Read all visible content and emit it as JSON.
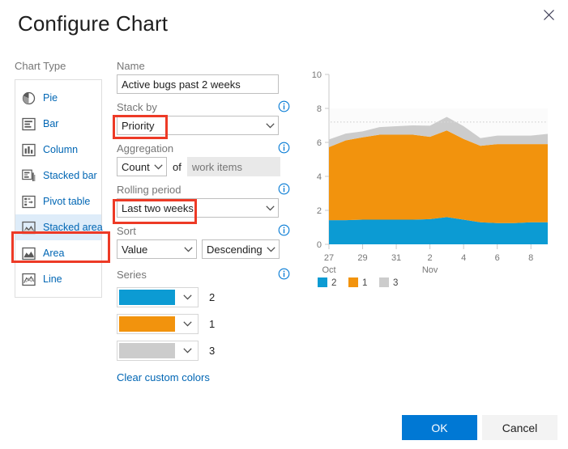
{
  "dialog": {
    "title": "Configure Chart",
    "close_icon": "close-icon"
  },
  "chart_type": {
    "label": "Chart Type",
    "selected": "Stacked area",
    "items": [
      {
        "label": "Pie",
        "icon": "pie-chart-icon"
      },
      {
        "label": "Bar",
        "icon": "bar-chart-icon"
      },
      {
        "label": "Column",
        "icon": "column-chart-icon"
      },
      {
        "label": "Stacked bar",
        "icon": "stacked-bar-chart-icon"
      },
      {
        "label": "Pivot table",
        "icon": "pivot-table-icon"
      },
      {
        "label": "Stacked area",
        "icon": "stacked-area-chart-icon"
      },
      {
        "label": "Area",
        "icon": "area-chart-icon"
      },
      {
        "label": "Line",
        "icon": "line-chart-icon"
      }
    ]
  },
  "form": {
    "name": {
      "label": "Name",
      "value": "Active bugs past 2 weeks",
      "placeholder": ""
    },
    "stack_by": {
      "label": "Stack by",
      "value": "Priority",
      "info_icon": "info-icon"
    },
    "aggregation": {
      "label": "Aggregation",
      "function": "Count",
      "of_label": "of",
      "field_placeholder": "work items",
      "field_value": "",
      "info_icon": "info-icon"
    },
    "rolling_period": {
      "label": "Rolling period",
      "value": "Last two weeks",
      "info_icon": "info-icon"
    },
    "sort": {
      "label": "Sort",
      "by_value": "Value",
      "direction_value": "Descending",
      "info_icon": "info-icon"
    },
    "series": {
      "label": "Series",
      "info_icon": "info-icon",
      "items": [
        {
          "name": "2",
          "color": "#0c9bd3"
        },
        {
          "name": "1",
          "color": "#f2930d"
        },
        {
          "name": "3",
          "color": "#cccccc"
        }
      ],
      "clear_colors_label": "Clear custom colors"
    }
  },
  "footer": {
    "ok_label": "OK",
    "cancel_label": "Cancel"
  },
  "annotations": {
    "accent_color": "#ed3a26",
    "highlighted": [
      "Stacked area",
      "Priority",
      "Last two weeks"
    ]
  },
  "chart_data": {
    "type": "area",
    "stacked": true,
    "title": "",
    "xlabel": "",
    "ylabel": "",
    "ylim": [
      0,
      10
    ],
    "yticks": [
      0,
      2,
      4,
      6,
      8,
      10
    ],
    "grid": false,
    "legend_position": "bottom-left",
    "reference_line": 7.2,
    "x": [
      "27",
      "28",
      "29",
      "30",
      "31",
      "1",
      "2",
      "3",
      "4",
      "5",
      "6",
      "7",
      "8",
      "9"
    ],
    "xticks": [
      "27",
      "29",
      "31",
      "2",
      "4",
      "6",
      "8"
    ],
    "month_labels": [
      {
        "label": "Oct",
        "at": "27"
      },
      {
        "label": "Nov",
        "at": "2"
      }
    ],
    "series": [
      {
        "name": "2",
        "color": "#0c9bd3",
        "values": [
          1.42,
          1.42,
          1.45,
          1.45,
          1.45,
          1.45,
          1.48,
          1.6,
          1.45,
          1.3,
          1.25,
          1.25,
          1.3,
          1.3
        ]
      },
      {
        "name": "1",
        "color": "#f2930d",
        "values": [
          4.3,
          4.7,
          4.85,
          5.0,
          5.0,
          5.0,
          4.85,
          5.1,
          4.75,
          4.5,
          4.65,
          4.65,
          4.6,
          4.6
        ]
      },
      {
        "name": "3",
        "color": "#cccccc",
        "values": [
          0.45,
          0.4,
          0.35,
          0.45,
          0.5,
          0.55,
          0.65,
          0.8,
          0.75,
          0.45,
          0.5,
          0.5,
          0.5,
          0.6
        ]
      }
    ],
    "legend": [
      {
        "label": "2",
        "color": "#0c9bd3"
      },
      {
        "label": "1",
        "color": "#f2930d"
      },
      {
        "label": "3",
        "color": "#cccccc"
      }
    ]
  }
}
